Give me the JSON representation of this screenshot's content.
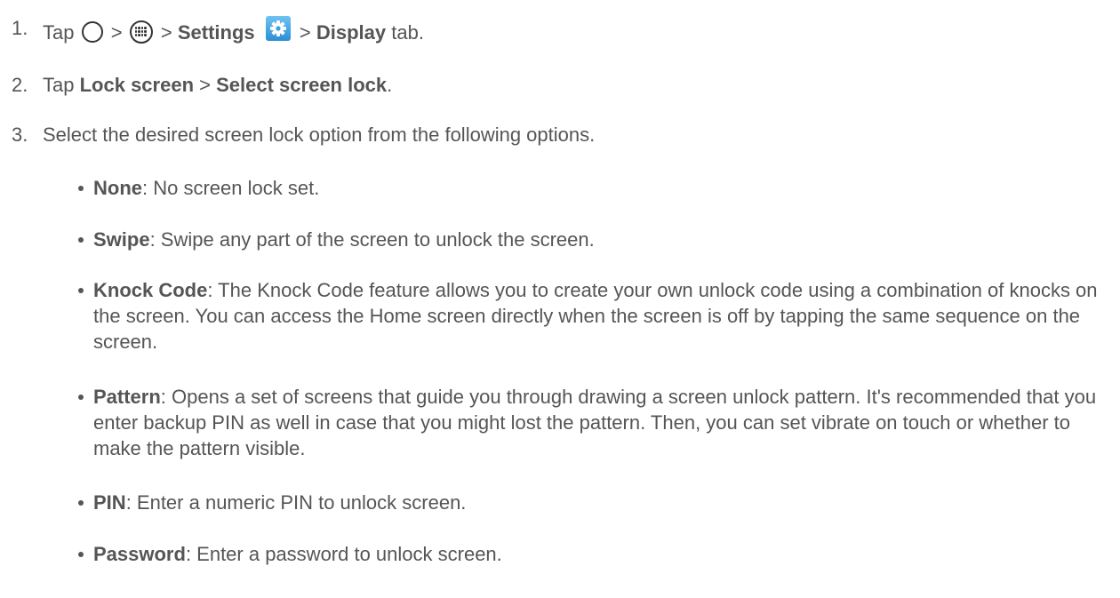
{
  "steps": [
    {
      "number": "1.",
      "tap_label": "Tap",
      "sep1": ">",
      "sep2": ">",
      "settings_label": "Settings",
      "sep3": ">",
      "display_label": "Display",
      "tab_label": "tab.",
      "icons": [
        "home-circle-icon",
        "apps-grid-icon",
        "settings-gear-icon"
      ]
    },
    {
      "number": "2.",
      "tap_label": "Tap",
      "lock_screen_label": "Lock screen",
      "sep": ">",
      "select_lock_label": "Select screen lock",
      "end": "."
    },
    {
      "number": "3.",
      "text": "Select the desired screen lock option from the following options."
    }
  ],
  "options": [
    {
      "name": "None",
      "description": ": No screen lock set."
    },
    {
      "name": "Swipe",
      "description": ": Swipe any part of the screen to unlock the screen."
    },
    {
      "name": "Knock Code",
      "description": ": The Knock Code feature allows you to create your own unlock code using a combination of knocks on the screen. You can access the Home screen directly when the screen is off by tapping the same sequence on the screen."
    },
    {
      "name": "Pattern",
      "description": ": Opens a set of screens that guide you through drawing a screen unlock pattern. It's recommended that you enter backup PIN as well in case that you might lost the pattern. Then, you can set vibrate on touch or whether to make the pattern visible."
    },
    {
      "name": "PIN",
      "description": ": Enter a numeric PIN to unlock screen."
    },
    {
      "name": "Password",
      "description": ": Enter a password to unlock screen."
    }
  ],
  "colors": {
    "text": "#555555",
    "icon_stroke": "#333333",
    "gear_bg": "#3aa0e0"
  }
}
